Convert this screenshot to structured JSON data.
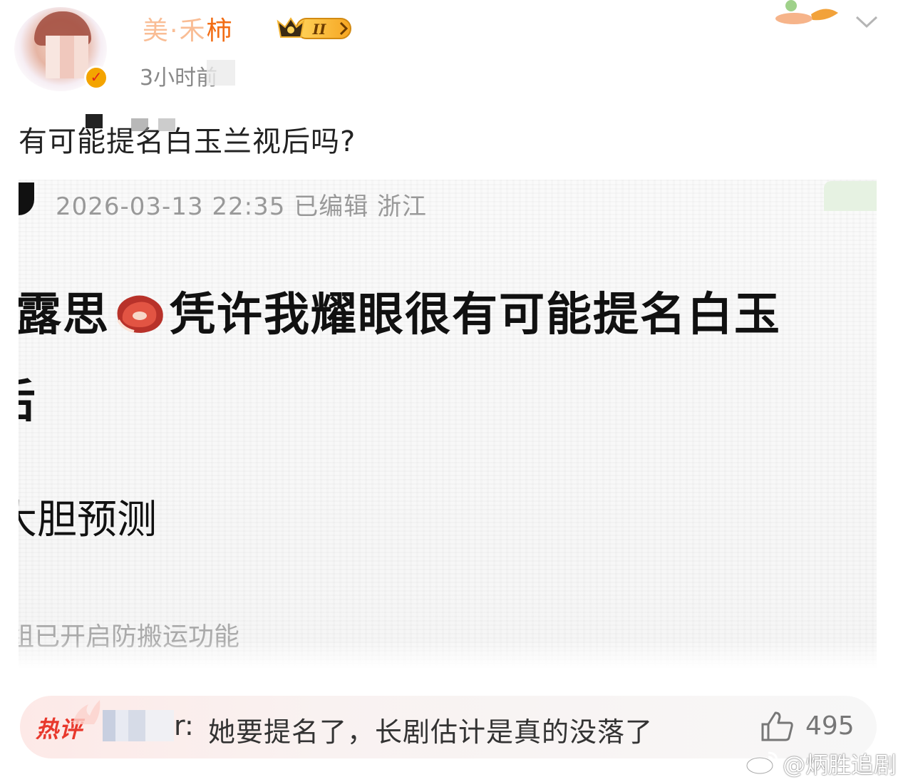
{
  "header": {
    "username": "美·禾柿",
    "level_badge": "II",
    "time_ago": "3小时前"
  },
  "post": {
    "text": "有可能提名白玉兰视后吗?"
  },
  "embedded_screenshot": {
    "meta": "2026-03-13 22:35  已编辑  浙江",
    "line1_prefix": "露思",
    "line1_rest": "凭许我耀眼很有可能提名白玉",
    "line2": "后",
    "line3": "大胆预测",
    "footer": "组已开启防搬运功能"
  },
  "hot_comment": {
    "tag": "热评",
    "user_suffix": "r:",
    "text": "她要提名了，长剧估计是真的没落了",
    "likes": "495"
  },
  "watermark": "@炳胜追剧",
  "colors": {
    "username": "#f26d15",
    "hot_tag": "#e8382c",
    "muted": "#999999"
  },
  "icons": [
    "crown-badge-icon",
    "verified-icon",
    "chevron-down-icon",
    "meat-emoji-icon",
    "flame-icon",
    "thumbs-up-icon",
    "weibo-logo-icon"
  ]
}
